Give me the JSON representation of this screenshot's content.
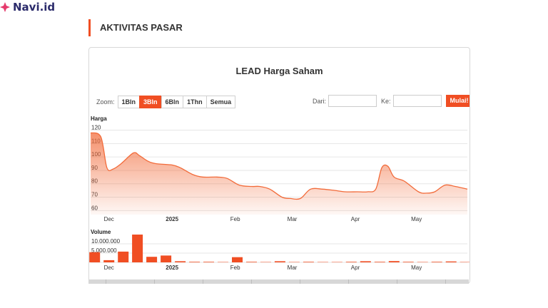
{
  "brand": {
    "name": "Navi.id",
    "accent": "#f04e23",
    "logo_color": "#e53a6c",
    "text_color": "#2b2b6b"
  },
  "section": {
    "title": "AKTIVITAS PASAR"
  },
  "chart": {
    "title": "LEAD Harga Saham",
    "zoom_label": "Zoom:",
    "zoom_buttons": [
      {
        "label": "1Bln",
        "active": false
      },
      {
        "label": "3Bln",
        "active": true
      },
      {
        "label": "6Bln",
        "active": false
      },
      {
        "label": "1Thn",
        "active": false
      },
      {
        "label": "Semua",
        "active": false
      }
    ],
    "from_label": "Dari:",
    "to_label": "Ke:",
    "from_value": "",
    "to_value": "",
    "start_button": "Mulai!"
  },
  "chart_data": [
    {
      "type": "area",
      "ylabel": "Harga",
      "y_ticks": [
        60,
        70,
        80,
        90,
        100,
        110,
        120
      ],
      "ylim": [
        57,
        124
      ],
      "x_tick_labels": [
        "Dec",
        "2025",
        "Feb",
        "Mar",
        "Apr",
        "May"
      ],
      "x_tick_dates": [
        "2024-12-01",
        "2025-01-01",
        "2025-02-01",
        "2025-03-01",
        "2025-04-01",
        "2025-05-01"
      ],
      "x_range": [
        "2024-11-22",
        "2025-05-26"
      ],
      "color": "#f26b3a",
      "series": [
        {
          "x": [
            "2024-11-22",
            "2024-11-27",
            "2024-11-30",
            "2024-12-03",
            "2024-12-07",
            "2024-12-13",
            "2024-12-16",
            "2024-12-20",
            "2024-12-24",
            "2025-01-01",
            "2025-01-05",
            "2025-01-11",
            "2025-01-16",
            "2025-01-23",
            "2025-01-28",
            "2025-02-03",
            "2025-02-09",
            "2025-02-13",
            "2025-02-18",
            "2025-02-24",
            "2025-02-28",
            "2025-03-05",
            "2025-03-10",
            "2025-03-16",
            "2025-03-22",
            "2025-03-27",
            "2025-04-02",
            "2025-04-07",
            "2025-04-11",
            "2025-04-14",
            "2025-04-17",
            "2025-04-20",
            "2025-04-25",
            "2025-05-02",
            "2025-05-06",
            "2025-05-10",
            "2025-05-15",
            "2025-05-20",
            "2025-05-26"
          ],
          "y": [
            118,
            115,
            92,
            91,
            95,
            103,
            101,
            97,
            95,
            94,
            92,
            87,
            85,
            85,
            84,
            79,
            78,
            78,
            76,
            70,
            69,
            69,
            76,
            76,
            75,
            74,
            74,
            74,
            76,
            92,
            93,
            85,
            82,
            74,
            73,
            74,
            79,
            78,
            76
          ]
        }
      ]
    },
    {
      "type": "bar",
      "ylabel": "Volume",
      "y_ticks": [
        0,
        5000000,
        10000000
      ],
      "y_tick_labels": [
        "0",
        "5.000.000",
        "10.000.000"
      ],
      "ylim": [
        0,
        15000000
      ],
      "x_tick_labels": [
        "Dec",
        "2025",
        "Feb",
        "Mar",
        "Apr",
        "May"
      ],
      "x_tick_dates": [
        "2024-12-01",
        "2025-01-01",
        "2025-02-01",
        "2025-03-01",
        "2025-04-01",
        "2025-05-01"
      ],
      "x_range": [
        "2024-11-22",
        "2025-05-26"
      ],
      "color": "#f04e23",
      "series": [
        {
          "x": [
            "2024-11-24",
            "2024-12-01",
            "2024-12-08",
            "2024-12-15",
            "2024-12-22",
            "2024-12-29",
            "2025-01-05",
            "2025-01-12",
            "2025-01-19",
            "2025-01-26",
            "2025-02-02",
            "2025-02-09",
            "2025-02-16",
            "2025-02-23",
            "2025-03-02",
            "2025-03-09",
            "2025-03-16",
            "2025-03-23",
            "2025-03-30",
            "2025-04-06",
            "2025-04-13",
            "2025-04-20",
            "2025-04-27",
            "2025-05-04",
            "2025-05-11",
            "2025-05-18",
            "2025-05-25"
          ],
          "y": [
            5500000,
            1200000,
            5800000,
            15000000,
            3000000,
            3700000,
            600000,
            300000,
            300000,
            200000,
            2800000,
            300000,
            200000,
            600000,
            200000,
            300000,
            200000,
            200000,
            300000,
            600000,
            300000,
            700000,
            300000,
            200000,
            300000,
            500000,
            200000
          ]
        }
      ]
    }
  ]
}
